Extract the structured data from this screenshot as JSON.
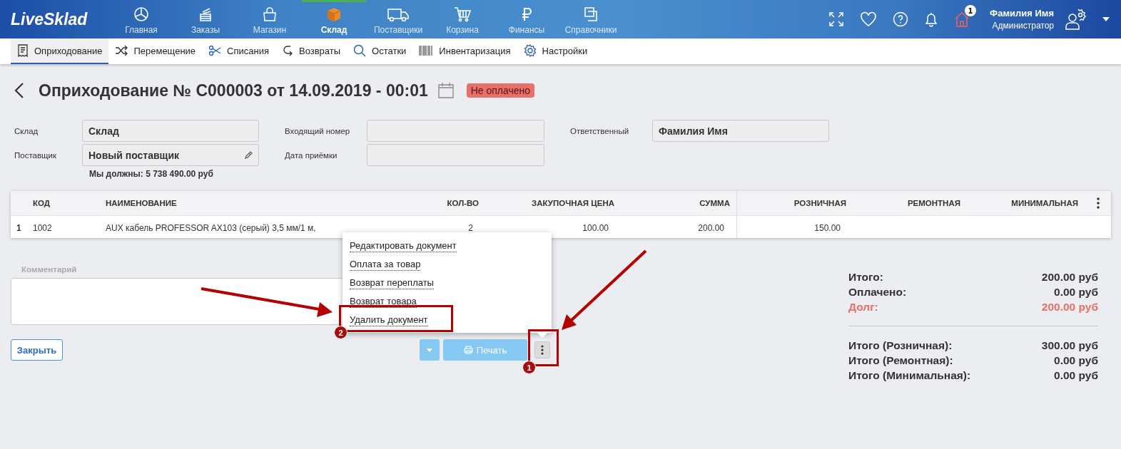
{
  "header": {
    "logo": "LiveSklad",
    "nav": [
      {
        "label": "Главная",
        "selected": false
      },
      {
        "label": "Заказы",
        "selected": false
      },
      {
        "label": "Магазин",
        "selected": false
      },
      {
        "label": "Склад",
        "selected": true
      },
      {
        "label": "Поставщики",
        "selected": false
      },
      {
        "label": "Корзина",
        "selected": false
      },
      {
        "label": "Финансы",
        "selected": false
      },
      {
        "label": "Справочники",
        "selected": false
      }
    ],
    "store_badge": "1",
    "user": {
      "name": "Фамилия Имя",
      "role": "Администратор"
    }
  },
  "subnav": [
    {
      "label": "Оприходование",
      "selected": true
    },
    {
      "label": "Перемещение",
      "selected": false
    },
    {
      "label": "Списания",
      "selected": false
    },
    {
      "label": "Возвраты",
      "selected": false
    },
    {
      "label": "Остатки",
      "selected": false
    },
    {
      "label": "Инвентаризация",
      "selected": false
    },
    {
      "label": "Настройки",
      "selected": false
    }
  ],
  "document": {
    "title": "Оприходование № C000003 от 14.09.2019 - 00:01",
    "status": "Не оплачено"
  },
  "fields": [
    {
      "label": "Склад",
      "value": "Склад"
    },
    {
      "label": "Входящий номер"
    },
    {
      "label": "Ответственный",
      "value": "Фамилия Имя"
    },
    {
      "label": "Поставщик",
      "value": "Новый поставщик",
      "editable": true
    },
    {
      "label": "Дата приёмки"
    }
  ],
  "debt_note": "Мы должны: 5 738 490.00 руб",
  "table": {
    "columns": [
      "",
      "КОД",
      "НАИМЕНОВАНИЕ",
      "КОЛ-ВО",
      "ЗАКУПОЧНАЯ ЦЕНА",
      "СУММА",
      "РОЗНИЧНАЯ",
      "РЕМОНТНАЯ",
      "МИНИМАЛЬНАЯ"
    ],
    "rows": [
      {
        "cells": [
          "1",
          "1002",
          "AUX кабель PROFESSOR AX103 (серый) 3,5 мм/1 м,",
          "2",
          "100.00",
          "200.00",
          "150.00"
        ]
      }
    ]
  },
  "comment": {
    "label": "Комментарий"
  },
  "buttons": {
    "close": "Закрыть",
    "print": "Печать"
  },
  "menu": [
    {
      "label": "Редактировать документ"
    },
    {
      "label": "Оплата за товар"
    },
    {
      "label": "Возврат переплаты"
    },
    {
      "label": "Возврат товара"
    },
    {
      "label": "Удалить документ"
    }
  ],
  "totals": [
    [
      {
        "label": "Итого:",
        "value": "200.00 руб",
        "kind": "normal"
      },
      {
        "label": "Оплачено:",
        "value": "0.00 руб",
        "kind": "normal"
      },
      {
        "label": "Долг:",
        "value": "200.00 руб",
        "kind": "debt"
      }
    ],
    [
      {
        "label": "Итого (Розничная):",
        "value": "300.00 руб",
        "kind": "normal"
      },
      {
        "label": "Итого (Ремонтная):",
        "value": "0.00 руб",
        "kind": "normal"
      },
      {
        "label": "Итого (Минимальная):",
        "value": "0.00 руб",
        "kind": "normal"
      }
    ]
  ],
  "annotations": [
    {
      "label": "1"
    },
    {
      "label": "2"
    }
  ]
}
